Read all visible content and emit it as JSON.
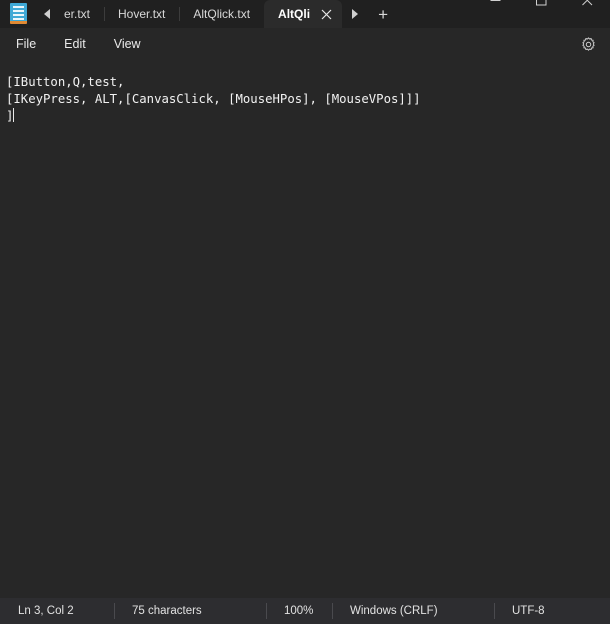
{
  "window": {
    "controls": [
      {
        "name": "minimize",
        "glyph": "minimize-icon"
      },
      {
        "name": "maximize",
        "glyph": "maximize-icon"
      },
      {
        "name": "close",
        "glyph": "close-icon"
      }
    ]
  },
  "tabbar": {
    "app_icon": "notepad-icon",
    "scroll_left": "chevron-left-icon",
    "scroll_right": "chevron-right-icon",
    "new_tab_label": "+",
    "tabs": [
      {
        "label": "er.txt",
        "active": false,
        "clipped": true
      },
      {
        "label": "Hover.txt",
        "active": false,
        "clipped": false
      },
      {
        "label": "AltQlick.txt",
        "active": false,
        "clipped": false
      },
      {
        "label": "AltQli",
        "active": true,
        "clipped": false
      }
    ],
    "close_label": "close-tab-icon"
  },
  "menubar": {
    "items": [
      {
        "label": "File"
      },
      {
        "label": "Edit"
      },
      {
        "label": "View"
      }
    ],
    "settings_icon": "gear-icon"
  },
  "editor": {
    "lines": [
      "[IButton,Q,test,",
      "[IKeyPress, ALT,[CanvasClick, [MouseHPos], [MouseVPos]]]",
      "]"
    ],
    "text": "[IButton,Q,test,\n[IKeyPress, ALT,[CanvasClick, [MouseHPos], [MouseVPos]]]\n]"
  },
  "statusbar": {
    "position": "Ln 3, Col 2",
    "characters": "75 characters",
    "zoom": "100%",
    "line_ending": "Windows (CRLF)",
    "encoding": "UTF-8"
  },
  "colors": {
    "titlebar_bg": "#202020",
    "body_bg": "#272727",
    "active_tab_bg": "#2b2b2b",
    "statusbar_bg": "#2d2d30",
    "text": "#f2f2f2",
    "accent": "#3fa9d6"
  }
}
